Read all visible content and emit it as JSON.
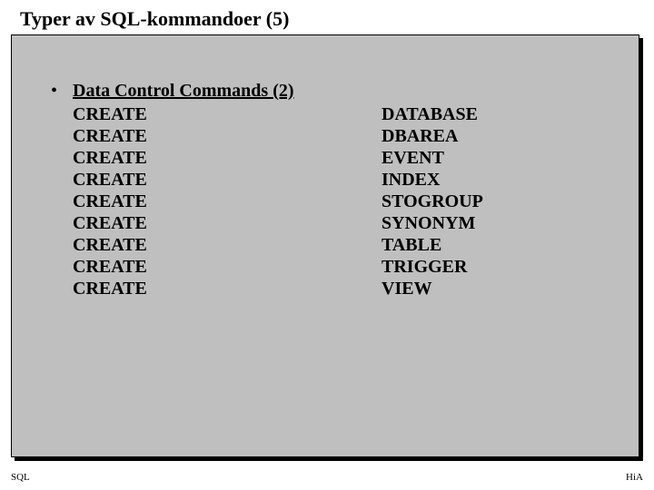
{
  "title": "Typer av SQL-kommandoer (5)",
  "heading": "Data Control Commands (2)",
  "bullet": "•",
  "commands": [
    {
      "left": "CREATE",
      "right": "DATABASE"
    },
    {
      "left": "CREATE",
      "right": "DBAREA"
    },
    {
      "left": "CREATE",
      "right": "EVENT"
    },
    {
      "left": "CREATE",
      "right": "INDEX"
    },
    {
      "left": "CREATE",
      "right": "STOGROUP"
    },
    {
      "left": "CREATE",
      "right": "SYNONYM"
    },
    {
      "left": "CREATE",
      "right": "TABLE"
    },
    {
      "left": "CREATE",
      "right": "TRIGGER"
    },
    {
      "left": "CREATE",
      "right": "VIEW"
    }
  ],
  "footer": {
    "left": "SQL",
    "right": "HiA"
  }
}
